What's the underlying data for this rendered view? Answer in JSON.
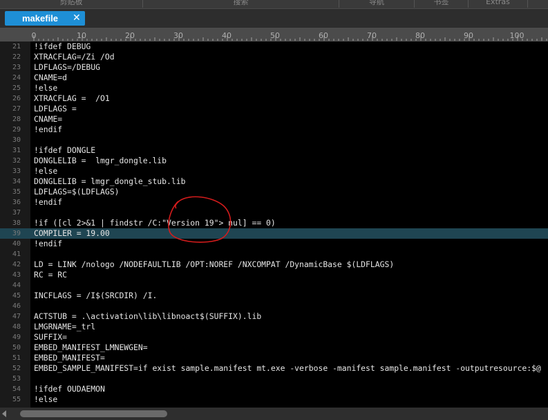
{
  "toolbar": {
    "items": [
      "剪贴板",
      "搜索",
      "导航",
      "书签",
      "Extras"
    ]
  },
  "tab": {
    "label": "makefile",
    "close_glyph": "✕"
  },
  "ruler": {
    "labels": [
      "0",
      "10",
      "20",
      "30",
      "40",
      "50",
      "60",
      "70",
      "80",
      "90",
      "100"
    ]
  },
  "editor": {
    "current_line": 39,
    "lines": [
      {
        "n": "21",
        "text": "!ifdef DEBUG"
      },
      {
        "n": "22",
        "text": "XTRACFLAG=/Zi /Od"
      },
      {
        "n": "23",
        "text": "LDFLAGS=/DEBUG"
      },
      {
        "n": "24",
        "text": "CNAME=d"
      },
      {
        "n": "25",
        "text": "!else"
      },
      {
        "n": "26",
        "text": "XTRACFLAG =  /O1"
      },
      {
        "n": "27",
        "text": "LDFLAGS ="
      },
      {
        "n": "28",
        "text": "CNAME="
      },
      {
        "n": "29",
        "text": "!endif"
      },
      {
        "n": "30",
        "text": ""
      },
      {
        "n": "31",
        "text": "!ifdef DONGLE"
      },
      {
        "n": "32",
        "text": "DONGLELIB =  lmgr_dongle.lib"
      },
      {
        "n": "33",
        "text": "!else"
      },
      {
        "n": "34",
        "text": "DONGLELIB = lmgr_dongle_stub.lib"
      },
      {
        "n": "35",
        "text": "LDFLAGS=$(LDFLAGS)"
      },
      {
        "n": "36",
        "text": "!endif"
      },
      {
        "n": "37",
        "text": ""
      },
      {
        "n": "38",
        "text": "!if ([cl 2>&1 | findstr /C:\"Version 19\"> nul] == 0)"
      },
      {
        "n": "39",
        "text": "COMPILER = 19.00"
      },
      {
        "n": "40",
        "text": "!endif"
      },
      {
        "n": "41",
        "text": ""
      },
      {
        "n": "42",
        "text": "LD = LINK /nologo /NODEFAULTLIB /OPT:NOREF /NXCOMPAT /DynamicBase $(LDFLAGS)"
      },
      {
        "n": "43",
        "text": "RC = RC"
      },
      {
        "n": "44",
        "text": ""
      },
      {
        "n": "45",
        "text": "INCFLAGS = /I$(SRCDIR) /I."
      },
      {
        "n": "46",
        "text": ""
      },
      {
        "n": "47",
        "text": "ACTSTUB = .\\activation\\lib\\libnoact$(SUFFIX).lib"
      },
      {
        "n": "48",
        "text": "LMGRNAME=_trl"
      },
      {
        "n": "49",
        "text": "SUFFIX="
      },
      {
        "n": "50",
        "text": "EMBED_MANIFEST_LMNEWGEN="
      },
      {
        "n": "51",
        "text": "EMBED_MANIFEST="
      },
      {
        "n": "52",
        "text": "EMBED_SAMPLE_MANIFEST=if exist sample.manifest mt.exe -verbose -manifest sample.manifest -outputresource:$@"
      },
      {
        "n": "53",
        "text": ""
      },
      {
        "n": "54",
        "text": "!ifdef OUDAEMON"
      },
      {
        "n": "55",
        "text": "!else"
      }
    ]
  },
  "colors": {
    "tab_active": "#1e8fd6",
    "editor_bg": "#000000",
    "current_line_bg": "#1f4552",
    "annotation": "#d41c1c"
  }
}
